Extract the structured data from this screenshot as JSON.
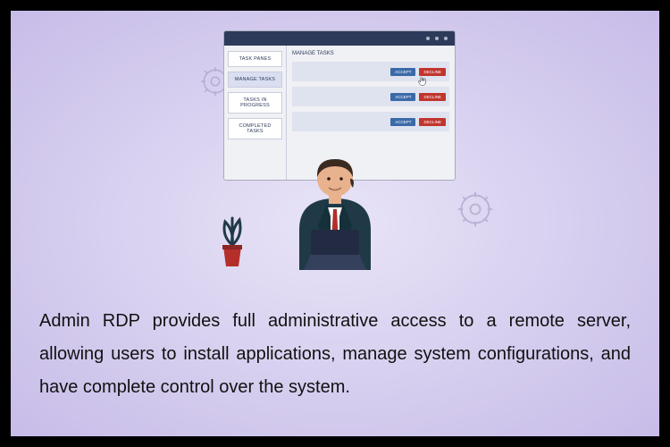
{
  "window": {
    "sidebar": {
      "items": [
        {
          "label": "TASK PANES"
        },
        {
          "label": "MANAGE TASKS"
        },
        {
          "label": "TASKS IN PROGRESS"
        },
        {
          "label": "COMPLETED TASKS"
        }
      ]
    },
    "panel": {
      "title": "MANAGE TASKS",
      "accept_label": "ACCEPT",
      "decline_label": "DECLINE"
    }
  },
  "caption": "Admin RDP provides full administrative access to a remote server, allowing users to install applications, manage system configurations, and have complete control over the system."
}
